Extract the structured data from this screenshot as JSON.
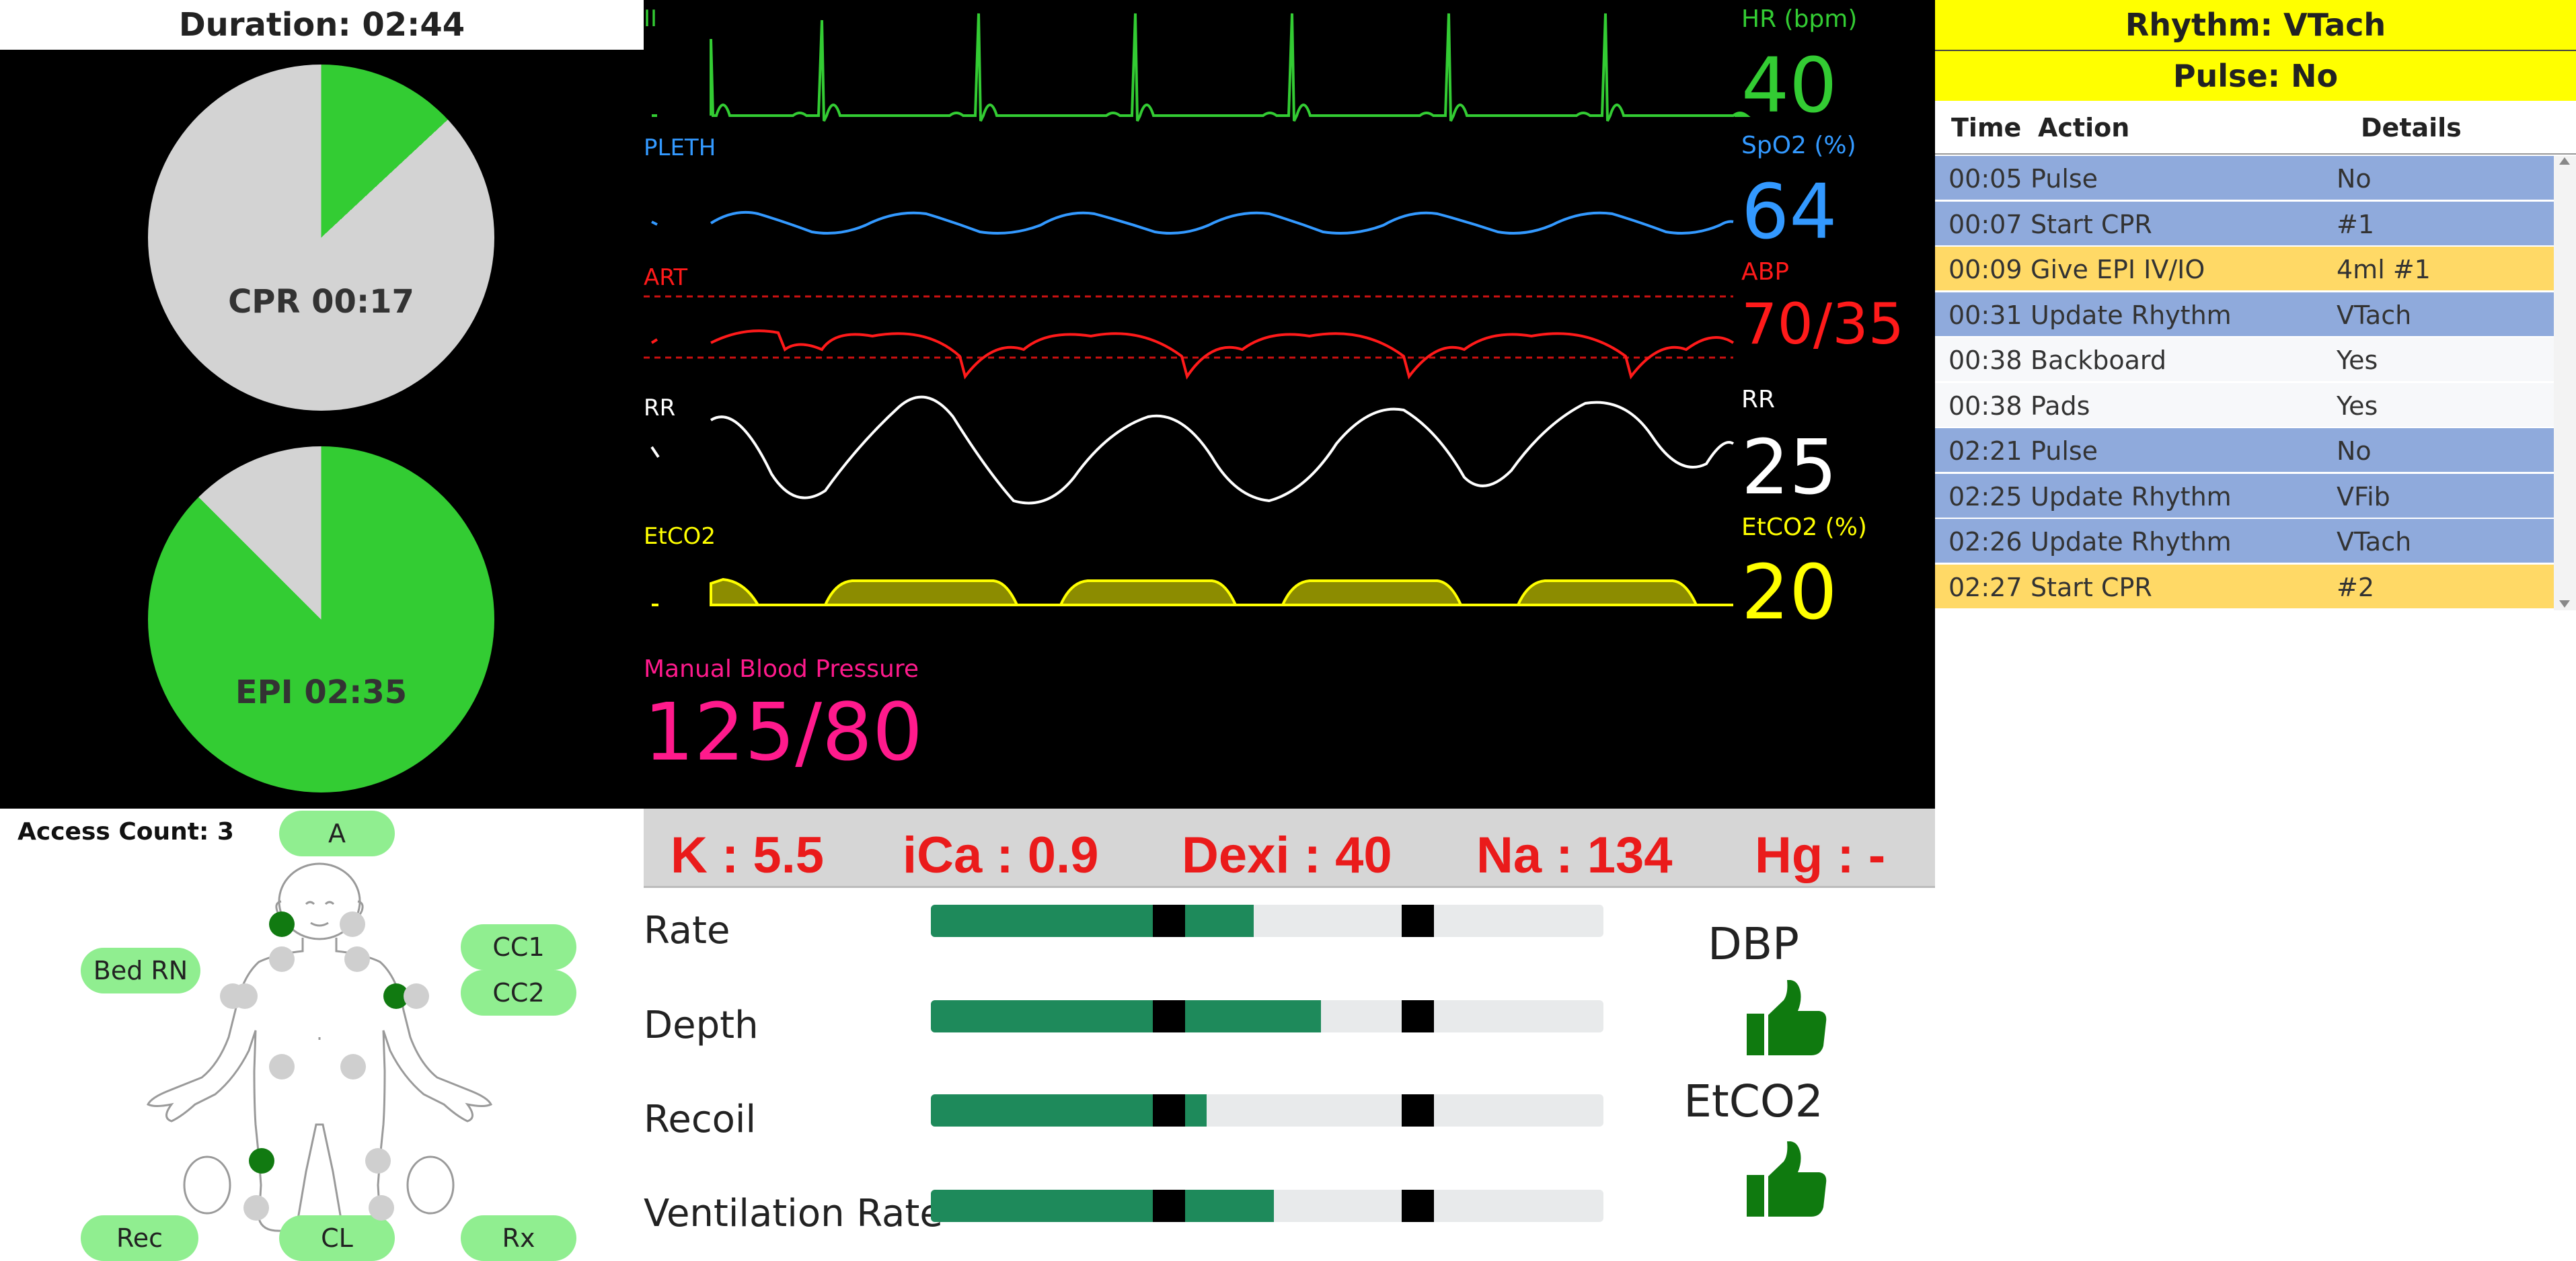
{
  "timers": {
    "duration": "Duration: 02:44",
    "cpr": {
      "label": "CPR 00:17",
      "fraction": 0.13
    },
    "epi": {
      "label": "EPI 02:35",
      "fraction": 0.875
    }
  },
  "monitor": {
    "waves": {
      "ecg": "II",
      "pleth": "PLETH",
      "art": "ART",
      "rr": "RR",
      "etco2": "EtCO2"
    },
    "params": {
      "hr": {
        "label": "HR (bpm)",
        "value": "40"
      },
      "spo2": {
        "label": "SpO2 (%)",
        "value": "64"
      },
      "abp": {
        "label": "ABP",
        "value": "70/35"
      },
      "rr": {
        "label": "RR",
        "value": "25"
      },
      "etco2": {
        "label": "EtCO2 (%)",
        "value": "20"
      }
    },
    "manual_bp": {
      "label": "Manual Blood Pressure",
      "value": "125/80"
    },
    "colors": {
      "ecg": "#33cc33",
      "pleth": "#3399ff",
      "art": "#ff1a1a",
      "rr": "#ffffff",
      "etco2": "#ffff00",
      "manual_bp": "#ff1a8c"
    }
  },
  "rhythm": {
    "rhythm": "Rhythm: VTach",
    "pulse": "Pulse: No"
  },
  "log": {
    "headers": {
      "time": "Time",
      "action": "Action",
      "details": "Details"
    },
    "rows": [
      {
        "time": "00:05",
        "action": "Pulse",
        "details": "No",
        "color": "#8faadc"
      },
      {
        "time": "00:07",
        "action": "Start CPR",
        "details": "#1",
        "color": "#8faadc"
      },
      {
        "time": "00:09",
        "action": "Give EPI IV/IO",
        "details": "4ml #1",
        "color": "#ffd966"
      },
      {
        "time": "00:31",
        "action": "Update Rhythm",
        "details": "VTach",
        "color": "#8faadc"
      },
      {
        "time": "00:38",
        "action": "Backboard",
        "details": "Yes",
        "color": "#f7f8fa"
      },
      {
        "time": "00:38",
        "action": "Pads",
        "details": "Yes",
        "color": "#f7f8fa"
      },
      {
        "time": "02:21",
        "action": "Pulse",
        "details": "No",
        "color": "#8faadc"
      },
      {
        "time": "02:25",
        "action": "Update Rhythm",
        "details": "VFib",
        "color": "#8faadc"
      },
      {
        "time": "02:26",
        "action": "Update Rhythm",
        "details": "VTach",
        "color": "#8faadc"
      },
      {
        "time": "02:27",
        "action": "Start CPR",
        "details": "#2",
        "color": "#ffd966"
      }
    ]
  },
  "access": {
    "count": "Access Count: 3",
    "pills": {
      "a": "A",
      "bed_rn": "Bed RN",
      "cc1": "CC1",
      "cc2": "CC2",
      "rec": "Rec",
      "cl": "CL",
      "rx": "Rx"
    }
  },
  "labs": {
    "k": "K : 5.5",
    "ica": "iCa : 0.9",
    "dexi": "Dexi : 40",
    "na": "Na : 134",
    "hg": "Hg : -"
  },
  "quality": {
    "bars": [
      {
        "label": "Rate",
        "fill": 0.48
      },
      {
        "label": "Depth",
        "fill": 0.58
      },
      {
        "label": "Recoil",
        "fill": 0.41
      },
      {
        "label": "Ventilation Rate",
        "fill": 0.51
      }
    ],
    "goals": {
      "dbp": "DBP",
      "etco2": "EtCO2"
    }
  }
}
